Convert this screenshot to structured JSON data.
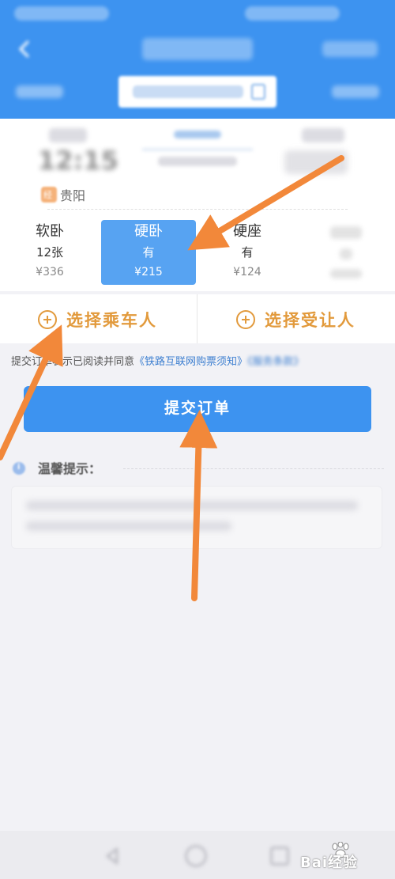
{
  "seats": [
    {
      "name": "软卧",
      "avail": "12张",
      "price": "¥336",
      "selected": false
    },
    {
      "name": "硬卧",
      "avail": "有",
      "price": "¥215",
      "selected": true
    },
    {
      "name": "硬座",
      "avail": "有",
      "price": "¥124",
      "selected": false
    }
  ],
  "train": {
    "dep_time": "12:15",
    "via_icon": "经",
    "via_station": "贵阳"
  },
  "passenger": {
    "select_passenger": "选择乘车人",
    "select_recipient": "选择受让人"
  },
  "agreement": {
    "prefix": "提交订单表示已阅读并同意",
    "link1": "《铁路互联网购票须知》",
    "link2": "《服务条款》"
  },
  "submit_label": "提交订单",
  "tips": {
    "title": "温馨提示："
  },
  "watermark": "Bai经验",
  "colors": {
    "brand_blue": "#3d93f0",
    "selected_seat": "#57a3f2",
    "accent_orange": "#e29a3c",
    "arrow_orange": "#f2883a"
  },
  "icons": [
    "back-icon",
    "calendar-icon",
    "plus-icon",
    "info-icon",
    "nav-back-icon",
    "nav-home-icon",
    "nav-recent-icon",
    "arrow-icon"
  ]
}
